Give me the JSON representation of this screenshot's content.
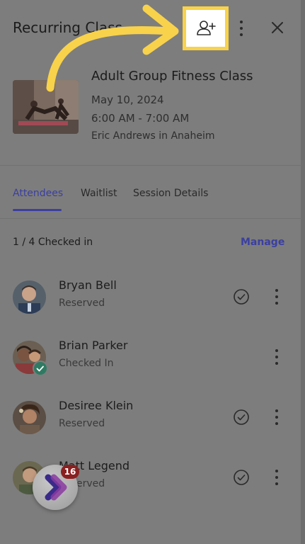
{
  "header": {
    "title": "Recurring Class",
    "icons": [
      "add-person-icon",
      "more-vertical-icon",
      "close-icon"
    ]
  },
  "class_info": {
    "name": "Adult Group Fitness Class",
    "date": "May 10, 2024",
    "time": "6:00 AM - 7:00 AM",
    "location": "Eric Andrews in Anaheim"
  },
  "tabs": [
    {
      "label": "Attendees",
      "active": true
    },
    {
      "label": "Waitlist",
      "active": false
    },
    {
      "label": "Session Details",
      "active": false
    }
  ],
  "attendees_section": {
    "checked_summary": "1 / 4 Checked in",
    "manage_label": "Manage"
  },
  "attendees": [
    {
      "name": "Bryan Bell",
      "status": "Reserved",
      "checked_in": false
    },
    {
      "name": "Brian Parker",
      "status": "Checked In",
      "checked_in": true
    },
    {
      "name": "Desiree Klein",
      "status": "Reserved",
      "checked_in": false
    },
    {
      "name": "Matt Legend",
      "status": "Reserved",
      "checked_in": false
    }
  ],
  "floating_widget": {
    "badge_count": "16"
  },
  "colors": {
    "accent": "#3b3fa0",
    "highlight": "#f8d24a",
    "checked_badge": "#2f7a62",
    "notification_badge": "#8a2020"
  }
}
